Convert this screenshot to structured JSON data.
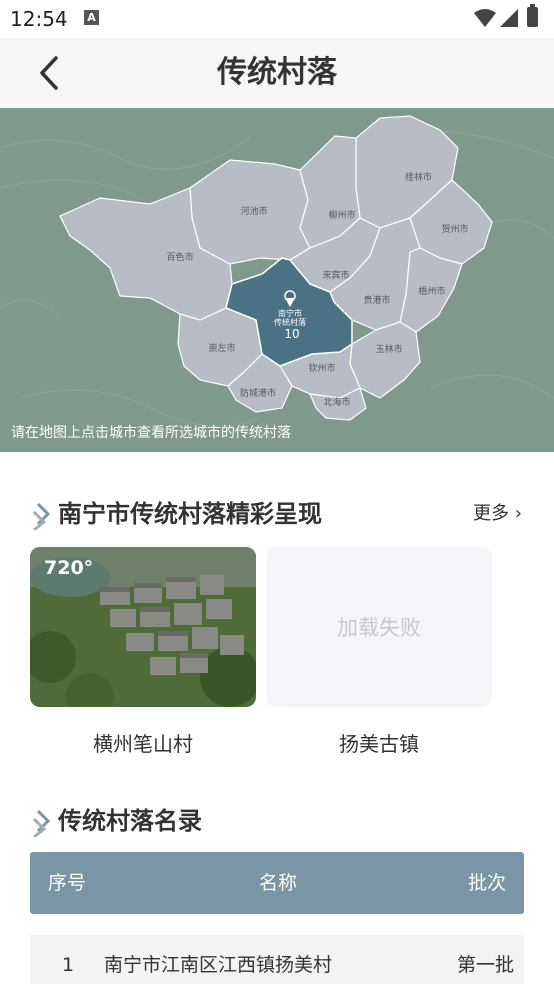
{
  "status_bar": {
    "time": "12:54",
    "a_icon": "A"
  },
  "header": {
    "title": "传统村落",
    "back_icon": "chevron-left-icon"
  },
  "map": {
    "hint": "请在地图上点击城市查看所选城市的传统村落",
    "selected_city": {
      "name": "南宁市",
      "sub": "传统村落",
      "count": "10"
    },
    "cities": [
      "桂林市",
      "河池市",
      "柳州市",
      "贺州市",
      "百色市",
      "来宾市",
      "梧州市",
      "贵港市",
      "崇左市",
      "玉林市",
      "钦州市",
      "防城港市",
      "北海市"
    ],
    "colors": {
      "region": "#b8bcc4",
      "selected": "#4a7184",
      "background": "#7f9a8c"
    }
  },
  "highlights": {
    "title": "南宁市传统村落精彩呈现",
    "more_label": "更多",
    "cards": [
      {
        "label": "横州笔山村",
        "badge": "720°"
      },
      {
        "label": "扬美古镇",
        "status": "加载失败"
      }
    ]
  },
  "directory": {
    "title": "传统村落名录",
    "columns": [
      "序号",
      "名称",
      "批次"
    ],
    "rows": [
      {
        "index": "1",
        "name": "南宁市江南区江西镇扬美村",
        "batch": "第一批"
      }
    ]
  }
}
